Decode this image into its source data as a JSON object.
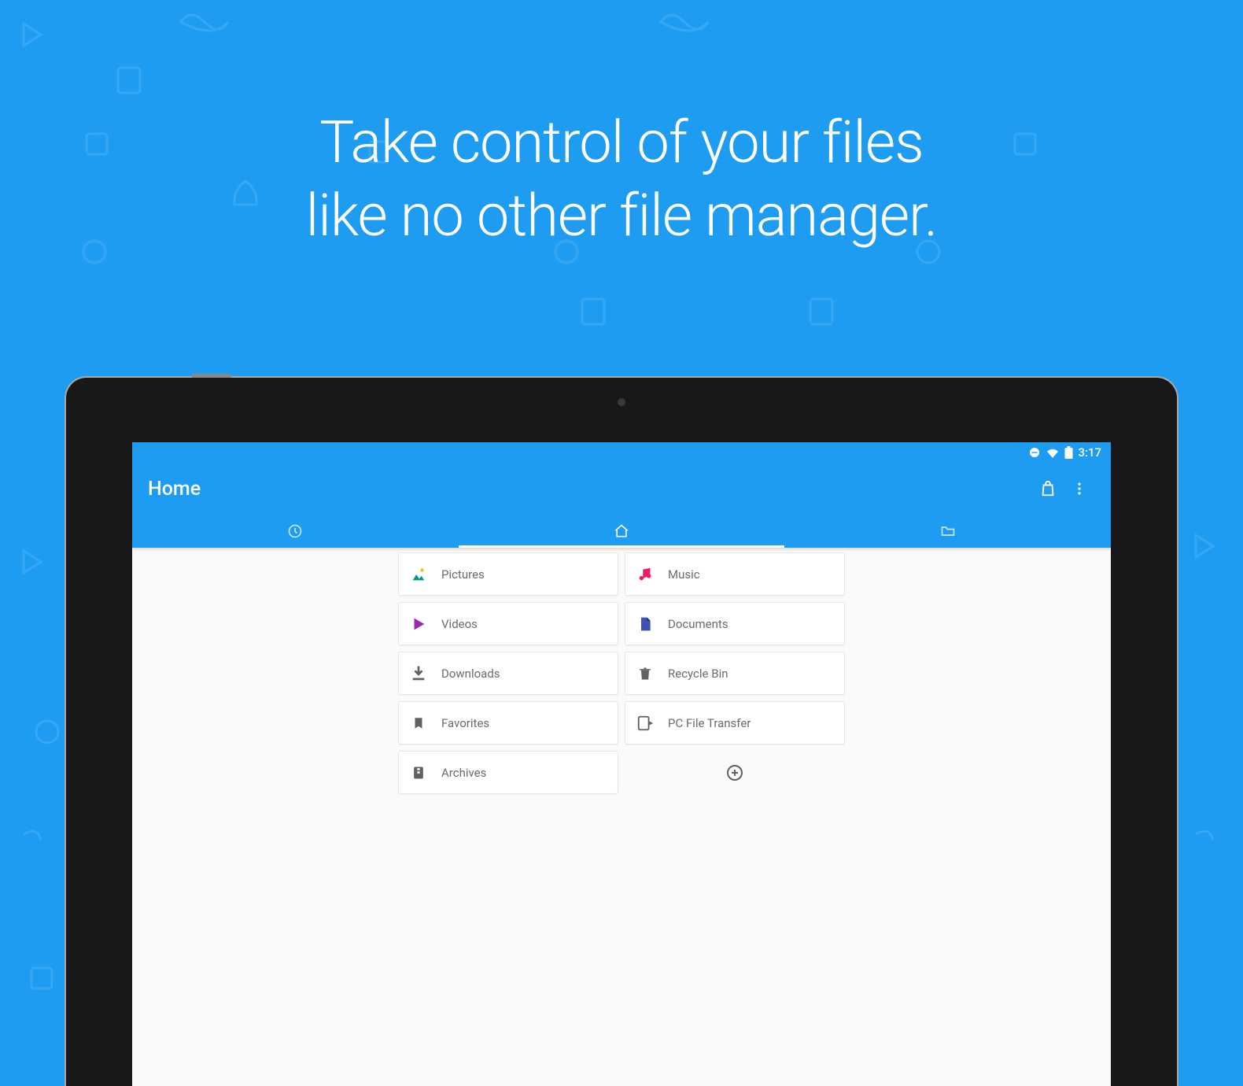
{
  "headline_line1": "Take control of your files",
  "headline_line2": "like no other file manager.",
  "status": {
    "time": "3:17"
  },
  "appbar": {
    "title": "Home"
  },
  "cards": {
    "pictures": "Pictures",
    "music": "Music",
    "videos": "Videos",
    "documents": "Documents",
    "downloads": "Downloads",
    "recycle": "Recycle Bin",
    "favorites": "Favorites",
    "pcft": "PC File Transfer",
    "archives": "Archives"
  },
  "colors": {
    "accent": "#1e9cf2",
    "teal": "#009688",
    "pink": "#e91e63",
    "purple": "#9c27b0",
    "indigo": "#3f51b5",
    "grey": "#616161"
  }
}
